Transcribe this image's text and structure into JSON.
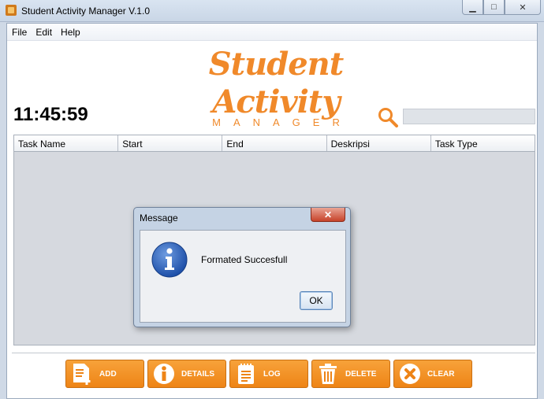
{
  "window": {
    "title": "Student Activity Manager V.1.0",
    "min_icon": "minimize-icon",
    "max_icon": "maximize-icon",
    "close_icon": "close-icon"
  },
  "menu": [
    "File",
    "Edit",
    "Help"
  ],
  "logo": {
    "main": "Student Activity",
    "sub": "MANAGER",
    "color": "#f0892a"
  },
  "clock": "11:45:59",
  "search": {
    "icon": "search-icon",
    "value": ""
  },
  "table": {
    "columns": [
      "Task Name",
      "Start",
      "End",
      "Deskripsi",
      "Task Type"
    ],
    "rows": []
  },
  "toolbar": [
    {
      "label": "ADD",
      "icon": "add-document-icon"
    },
    {
      "label": "DETAILS",
      "icon": "info-icon"
    },
    {
      "label": "LOG",
      "icon": "notepad-icon"
    },
    {
      "label": "DELETE",
      "icon": "trash-icon"
    },
    {
      "label": "CLEAR",
      "icon": "clear-x-icon"
    }
  ],
  "dialog": {
    "title": "Message",
    "message": "Formated Succesfull",
    "ok_label": "OK",
    "icon": "information-icon"
  },
  "colors": {
    "accent": "#f0892a",
    "button": "#ee8416"
  }
}
